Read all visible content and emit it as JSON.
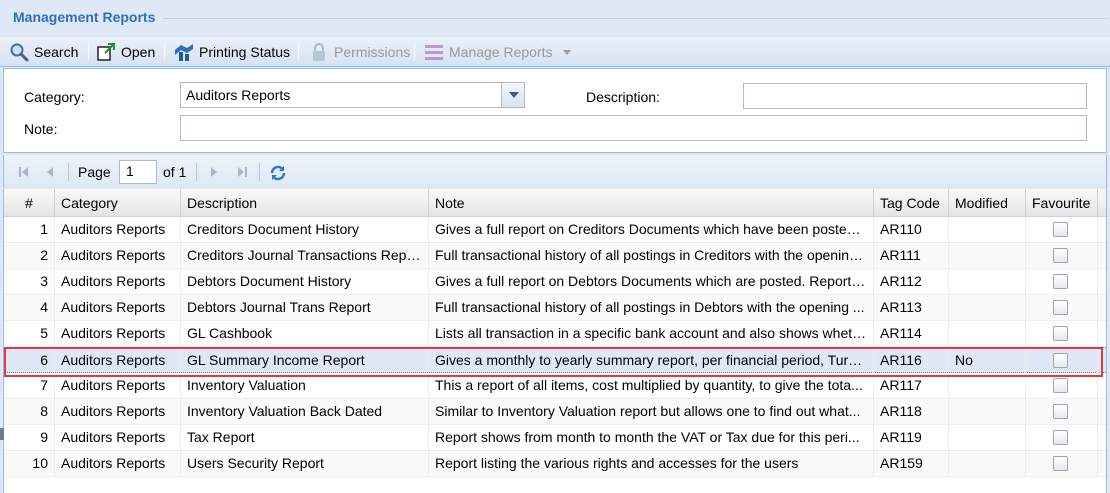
{
  "panel": {
    "title": "Management Reports"
  },
  "toolbar": {
    "search": "Search",
    "open": "Open",
    "printing_status": "Printing Status",
    "permissions": "Permissions",
    "manage_reports": "Manage Reports"
  },
  "form": {
    "category_label": "Category:",
    "category_value": "Auditors Reports",
    "description_label": "Description:",
    "description_value": "",
    "note_label": "Note:",
    "note_value": ""
  },
  "pager": {
    "page_label": "Page",
    "page_value": "1",
    "of_label": "of 1"
  },
  "grid": {
    "columns": [
      "#",
      "Category",
      "Description",
      "Note",
      "Tag Code",
      "Modified",
      "Favourite"
    ],
    "rows": [
      {
        "num": "1",
        "category": "Auditors Reports",
        "description": "Creditors Document History",
        "note": "Gives a full report on Creditors Documents which have been posted. ...",
        "tag": "AR110",
        "modified": ""
      },
      {
        "num": "2",
        "category": "Auditors Reports",
        "description": "Creditors Journal Transactions Report",
        "note": "Full transactional history of all postings in Creditors with the opening...",
        "tag": "AR111",
        "modified": ""
      },
      {
        "num": "3",
        "category": "Auditors Reports",
        "description": "Debtors Document History",
        "note": "Gives a full report on Debtors Documents which are posted. Report i...",
        "tag": "AR112",
        "modified": ""
      },
      {
        "num": "4",
        "category": "Auditors Reports",
        "description": "Debtors Journal Trans Report",
        "note": "Full transactional history of all postings in Debtors with the opening ...",
        "tag": "AR113",
        "modified": ""
      },
      {
        "num": "5",
        "category": "Auditors Reports",
        "description": "GL Cashbook",
        "note": "Lists all transaction in a specific bank account and also shows wheth...",
        "tag": "AR114",
        "modified": ""
      },
      {
        "num": "6",
        "category": "Auditors Reports",
        "description": "GL Summary Income Report",
        "note": "Gives a monthly to yearly summary report, per financial period, Turn...",
        "tag": "AR116",
        "modified": "No"
      },
      {
        "num": "7",
        "category": "Auditors Reports",
        "description": "Inventory Valuation",
        "note": "This a report of all items, cost multiplied by quantity, to give the tota...",
        "tag": "AR117",
        "modified": ""
      },
      {
        "num": "8",
        "category": "Auditors Reports",
        "description": "Inventory Valuation Back Dated",
        "note": "Similar to Inventory Valuation report but allows one to find out what...",
        "tag": "AR118",
        "modified": ""
      },
      {
        "num": "9",
        "category": "Auditors Reports",
        "description": "Tax Report",
        "note": "Report shows from month to month the VAT or Tax due for this peri...",
        "tag": "AR119",
        "modified": ""
      },
      {
        "num": "10",
        "category": "Auditors Reports",
        "description": "Users Security Report",
        "note": "Report listing the various rights and accesses for the users",
        "tag": "AR159",
        "modified": ""
      }
    ]
  },
  "colors": {
    "title": "#2e6fbd",
    "panel_bg": "#dfe8f6",
    "selected_row": "#dfe8f6",
    "highlight_border": "#e0393e"
  }
}
